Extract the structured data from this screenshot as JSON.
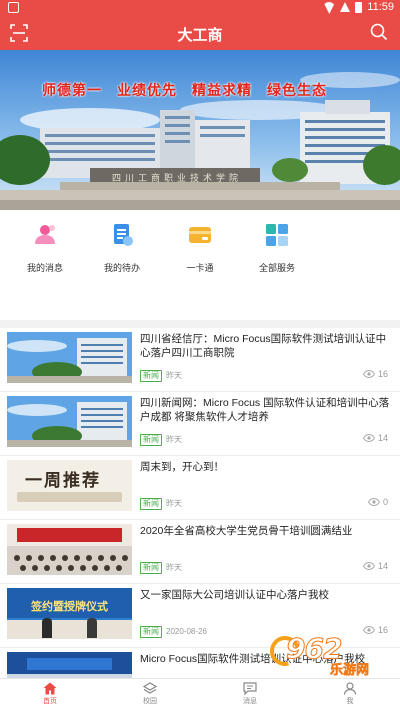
{
  "status_bar": {
    "time": "11:59"
  },
  "header": {
    "title": "大工商"
  },
  "banner": {
    "slogan": "师德第一　业绩优先　精益求精　绿色生态",
    "gate_text": "四川工商职业技术学院"
  },
  "quick_actions": [
    {
      "label": "我的消息",
      "icon": "person-message-icon"
    },
    {
      "label": "我的待办",
      "icon": "todo-document-icon"
    },
    {
      "label": "一卡通",
      "icon": "card-icon"
    },
    {
      "label": "全部服务",
      "icon": "grid-services-icon"
    }
  ],
  "news": [
    {
      "title": "四川省经信厅：Micro Focus国际软件测试培训认证中心落户四川工商职院",
      "tag": "新闻",
      "date": "昨天",
      "views": "16"
    },
    {
      "title": "四川新闻网：Micro Focus 国际软件认证和培训中心落户成都 将聚焦软件人才培养",
      "tag": "新闻",
      "date": "昨天",
      "views": "14"
    },
    {
      "title": "周末到，开心到！",
      "tag": "新闻",
      "date": "昨天",
      "views": "0",
      "thumb_text": "一周推荐"
    },
    {
      "title": "2020年全省高校大学生党员骨干培训圆满结业",
      "tag": "新闻",
      "date": "昨天",
      "views": "14"
    },
    {
      "title": "又一家国际大公司培训认证中心落户我校",
      "tag": "新闻",
      "date": "2020-08-26",
      "views": "16",
      "thumb_text": "签约暨授牌仪式"
    },
    {
      "title": "Micro Focus国际软件测试培训认证中心落户我校",
      "tag": "",
      "date": "",
      "views": ""
    }
  ],
  "bottom_nav": [
    {
      "label": "首页",
      "active": true
    },
    {
      "label": "校园",
      "active": false
    },
    {
      "label": "消息",
      "active": false
    },
    {
      "label": "我",
      "active": false
    }
  ],
  "watermark": {
    "number": "962",
    "text": "乐游网"
  },
  "colors": {
    "brand": "#e94c47",
    "tag_green": "#4caf50"
  }
}
